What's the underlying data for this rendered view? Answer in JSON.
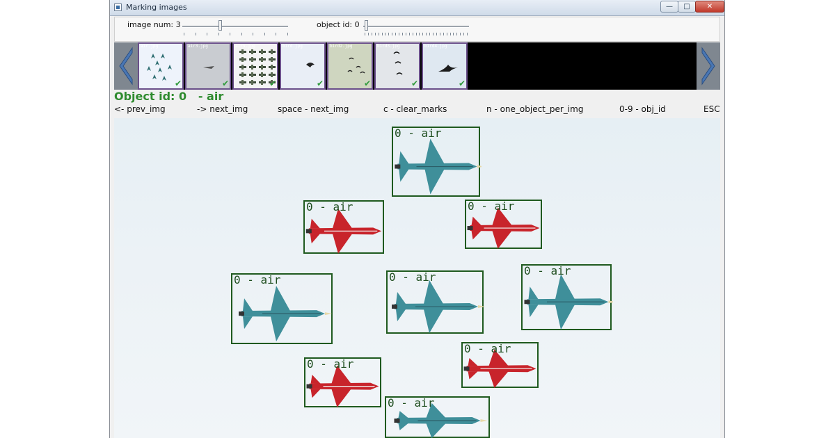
{
  "window": {
    "title": "Marking images",
    "buttons": {
      "minimize": "—",
      "maximize": "□",
      "close": "✕"
    }
  },
  "controls": {
    "image_num_label": "image num: 3",
    "image_num_value": 3,
    "object_id_label": "object id: 0",
    "object_id_value": 0
  },
  "thumbnails": [
    {
      "name": "air.jpg",
      "marked": true,
      "kind": "jets-formation"
    },
    {
      "name": "air3.jpg",
      "marked": true,
      "kind": "single-plane"
    },
    {
      "name": "air5.jpg",
      "marked": true,
      "kind": "many-planes"
    },
    {
      "name": "bird.jpg",
      "marked": true,
      "kind": "bird"
    },
    {
      "name": "bird2.jpg",
      "marked": true,
      "kind": "birds-sunset"
    },
    {
      "name": "bird3.jpg",
      "marked": true,
      "kind": "birds-flock"
    },
    {
      "name": "bird4.jpg",
      "marked": true,
      "kind": "bird-large"
    }
  ],
  "status": {
    "object_line": "Object id: 0   - air"
  },
  "help": {
    "prev": "<- prev_img",
    "next": "-> next_img",
    "space": "space - next_img",
    "clear": "c - clear_marks",
    "one_per_img": "n - one_object_per_img",
    "obj_id": "0-9 - obj_id",
    "esc": "ESC"
  },
  "marks": [
    {
      "label": "0 - air",
      "plane": "blue"
    },
    {
      "label": "0 - air",
      "plane": "red"
    },
    {
      "label": "0 - air",
      "plane": "red"
    },
    {
      "label": "0 - air",
      "plane": "blue"
    },
    {
      "label": "0 - air",
      "plane": "blue"
    },
    {
      "label": "0 - air",
      "plane": "blue"
    },
    {
      "label": "0 - air",
      "plane": "red"
    },
    {
      "label": "0 - air",
      "plane": "red"
    },
    {
      "label": "0 - air",
      "plane": "blue"
    }
  ],
  "colors": {
    "bbox": "#1f5a1f",
    "status_text": "#2e8b2e",
    "plane_blue": "#3f8f9a",
    "plane_red": "#c8242b",
    "arrow_panel": "#7f8790"
  }
}
